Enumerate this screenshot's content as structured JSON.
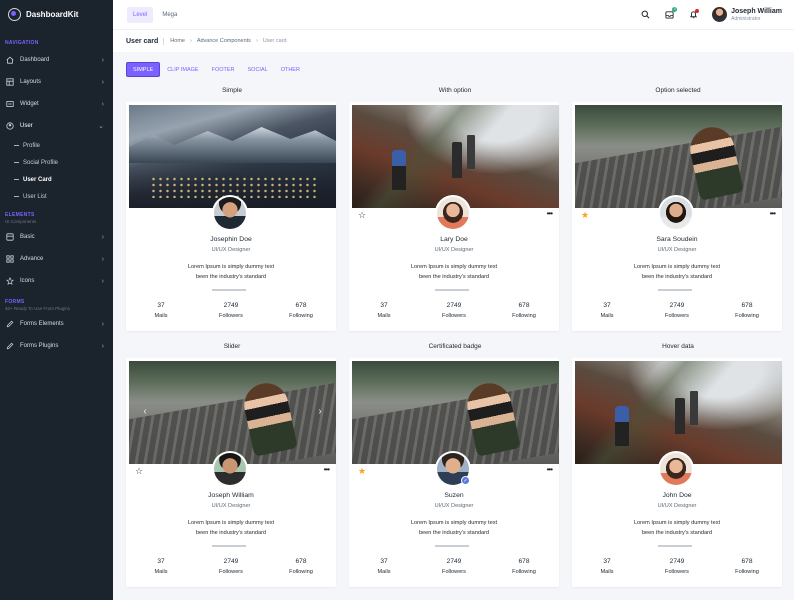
{
  "app": {
    "name": "DashboardKit"
  },
  "sidebar": {
    "nav_title": "NAVIGATION",
    "nav_items": [
      {
        "label": "Dashboard",
        "icon": "dashboard-icon"
      },
      {
        "label": "Layouts",
        "icon": "layouts-icon"
      },
      {
        "label": "Widget",
        "icon": "widget-icon"
      },
      {
        "label": "User",
        "icon": "user-icon"
      }
    ],
    "user_sub": [
      "Profile",
      "Social Profile",
      "User Card",
      "User List"
    ],
    "elements_title": "ELEMENTS",
    "elements_sub": "UI Components",
    "element_items": [
      {
        "label": "Basic",
        "icon": "basic-icon"
      },
      {
        "label": "Advance",
        "icon": "advance-icon"
      },
      {
        "label": "Icons",
        "icon": "icons-icon"
      }
    ],
    "forms_title": "FORMS",
    "forms_sub": "40+ Ready To Use From Plugins",
    "form_items": [
      {
        "label": "Forms Elements",
        "icon": "pencil-icon"
      },
      {
        "label": "Forms Plugins",
        "icon": "pencil-icon"
      }
    ]
  },
  "header": {
    "tabs": [
      "Level",
      "Mega"
    ],
    "user_name": "Joseph William",
    "user_role": "Administrator",
    "badge_green": "3",
    "badge_red": "",
    "accent": "#7b61ff"
  },
  "breadcrumb": {
    "title": "User card",
    "items": [
      "Home",
      "Advance Components",
      "User card"
    ]
  },
  "filters": [
    "SIMPLE",
    "CLIP IMAGE",
    "FOOTER",
    "SOCIAL",
    "OTHER"
  ],
  "cards": [
    {
      "section": "Simple",
      "name": "Josephin Doe",
      "role": "UI/UX Designer",
      "desc1": "Lorem Ipsum is simply dummy text",
      "desc2": "been the industry's standard",
      "mails": "37",
      "followers": "2749",
      "following": "678"
    },
    {
      "section": "With option",
      "name": "Lary Doe",
      "role": "UI/UX Designer",
      "desc1": "Lorem Ipsum is simply dummy text",
      "desc2": "been the industry's standard",
      "mails": "37",
      "followers": "2749",
      "following": "678"
    },
    {
      "section": "Option selected",
      "name": "Sara Soudein",
      "role": "UI/UX Designer",
      "desc1": "Lorem Ipsum is simply dummy text",
      "desc2": "been the industry's standard",
      "mails": "37",
      "followers": "2749",
      "following": "678"
    },
    {
      "section": "Slider",
      "name": "Joseph William",
      "role": "UI/UX Designer",
      "desc1": "Lorem Ipsum is simply dummy text",
      "desc2": "been the industry's standard",
      "mails": "37",
      "followers": "2749",
      "following": "678"
    },
    {
      "section": "Certificated badge",
      "name": "Suzen",
      "role": "UI/UX Designer",
      "desc1": "Lorem Ipsum is simply dummy text",
      "desc2": "been the industry's standard",
      "mails": "37",
      "followers": "2749",
      "following": "678"
    },
    {
      "section": "Hover data",
      "name": "John Doe",
      "role": "UI/UX Designer",
      "desc1": "Lorem Ipsum is simply dummy text",
      "desc2": "been the industry's standard",
      "mails": "37",
      "followers": "2749",
      "following": "678"
    }
  ],
  "stat_labels": {
    "mails": "Mails",
    "followers": "Followers",
    "following": "Following"
  },
  "icons": {
    "star_outline": "☆",
    "star_filled": "★",
    "more": "•••",
    "check": "✓",
    "chev_right": "›",
    "chev_down": "⌄",
    "slider_prev": "‹",
    "slider_next": "›"
  },
  "colors": {
    "star": "#f6a21a",
    "badge_green": "#2ca87f",
    "badge_red": "#dc2626"
  }
}
